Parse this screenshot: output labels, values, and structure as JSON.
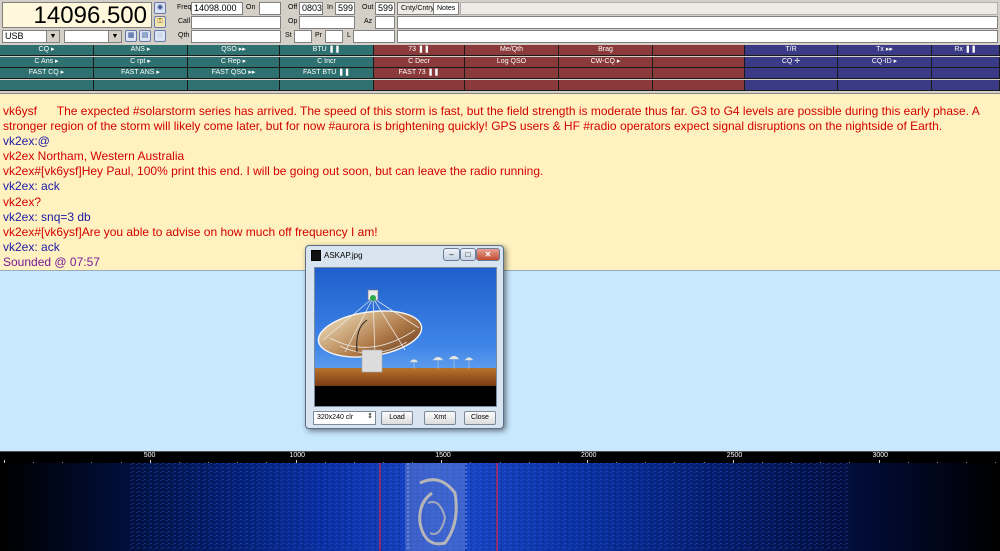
{
  "frequency": {
    "display": "14096.500",
    "mode": "USB"
  },
  "qso_fields": {
    "freq_label": "Freq",
    "freq_value": "14098.000",
    "on_label": "On",
    "on_value": "",
    "off_label": "Off",
    "off_value": "0803",
    "in_label": "In",
    "in_value": "599",
    "out_label": "Out",
    "out_value": "599",
    "call_label": "Call",
    "call_value": "",
    "op_label": "Op",
    "op_value": "",
    "az_label": "Az",
    "az_value": "",
    "qth_label": "Qth",
    "qth_value": "",
    "st_label": "St",
    "st_value": "",
    "pr_label": "Pr",
    "pr_value": "",
    "l_label": "L",
    "l_value": "",
    "tab_country": "Cnty/Cntry",
    "tab_notes": "Notes"
  },
  "macros": {
    "rows": [
      [
        "CQ ▸",
        "ANS ▸",
        "QSO ▸▸",
        "BTU ❚❚",
        "73 ❚❚",
        "Me/Qth",
        "Brag",
        "",
        "T/R",
        "Tx ▸▸",
        "Rx ❚❚"
      ],
      [
        "C Ans ▸",
        "C rpt ▸",
        "C Rep ▸",
        "C Incr",
        "C Decr",
        "Log QSO",
        "CW-CQ ▸",
        "",
        "CQ ✛",
        "CQ-ID ▸",
        ""
      ],
      [
        "FAST CQ ▸",
        "FAST ANS ▸",
        "FAST QSO ▸▸",
        "FAST BTU ❚❚",
        "FAST 73 ❚❚",
        "",
        "",
        "",
        "",
        "",
        ""
      ],
      [
        "",
        "",
        "",
        "",
        "",
        "",
        "",
        "",
        "",
        "",
        ""
      ]
    ]
  },
  "rx_text": [
    {
      "text": "vk6ysf      The expected #solarstorm series has arrived. The speed of this storm is fast, but the field strength is moderate thus far. G3 to G4 levels are possible during this early phase. A stronger region of the storm will likely come later, but for now #aurora is brightening quickly! GPS users & HF #radio operators expect signal disruptions on the nightside of Earth.",
      "color": "red"
    },
    {
      "text": "vk2ex:@",
      "color": "blue"
    },
    {
      "text": "vk2ex Northam, Western Australia",
      "color": "red"
    },
    {
      "text": "vk2ex#[vk6ysf]Hey Paul, 100% print this end. I will be going out soon, but can leave the radio running.",
      "color": "red"
    },
    {
      "text": "vk2ex: ack",
      "color": "blue"
    },
    {
      "text": "vk2ex?",
      "color": "red"
    },
    {
      "text": "vk2ex: snq=3 db",
      "color": "blue"
    },
    {
      "text": "vk2ex#[vk6ysf]Are you able to advise on how much off frequency I am!",
      "color": "red"
    },
    {
      "text": "vk2ex: ack",
      "color": "blue"
    },
    {
      "text": "Sounded @ 07:57",
      "color": "purple"
    }
  ],
  "waterfall": {
    "ticks": [
      "500",
      "1000",
      "1500",
      "2000",
      "2500",
      "3000"
    ]
  },
  "image_dialog": {
    "title": "ASKAP.jpg",
    "size_option": "320x240 clr",
    "load_label": "Load",
    "xmt_label": "Xmt",
    "close_label": "Close"
  },
  "colors": {
    "rx_background": "#fff2c0",
    "tx_background": "#c8e8ff",
    "macro_group1": "#2f7070",
    "macro_group2": "#8a3a3a",
    "macro_group3": "#3a3a86"
  }
}
